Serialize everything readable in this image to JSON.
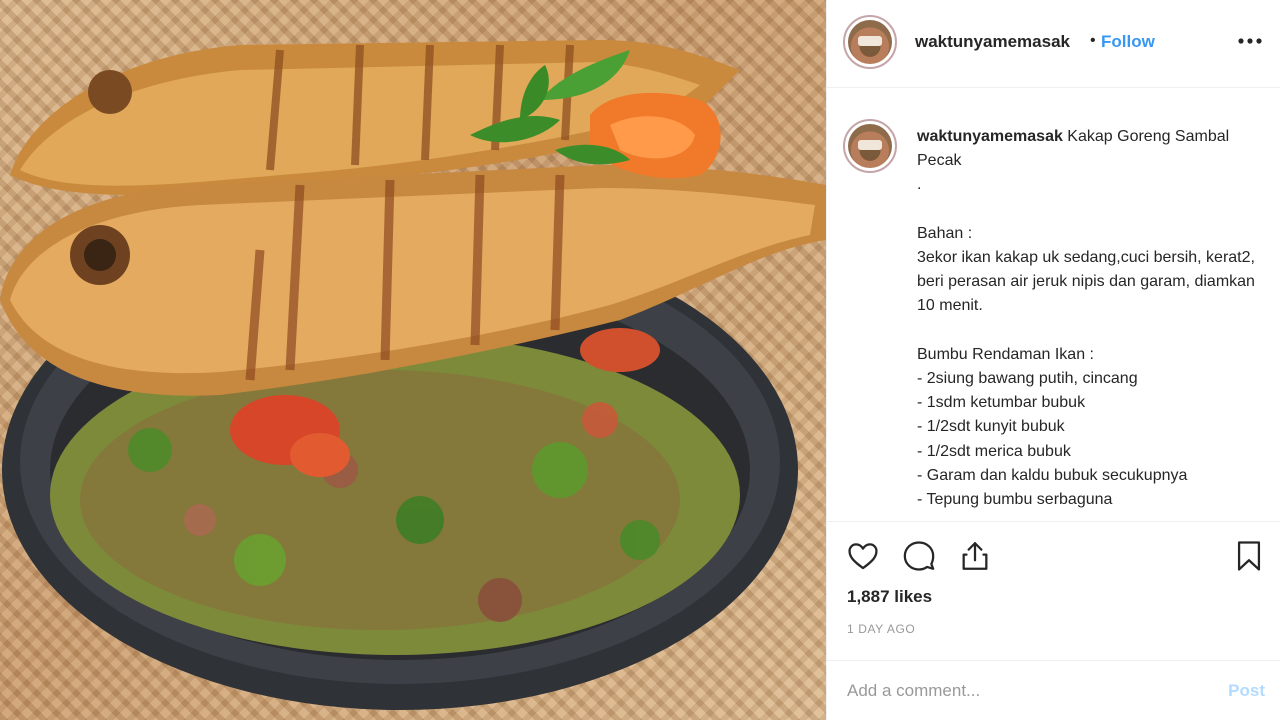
{
  "post": {
    "image_alt": "Kakap Goreng Sambal Pecak"
  },
  "header": {
    "username": "waktunyamemasak",
    "separator": "•",
    "follow_label": "Follow",
    "more_icon": "more-horizontal-icon"
  },
  "caption": {
    "username": "waktunyamemasak",
    "text": " Kakap Goreng Sambal Pecak\n.\n\nBahan :\n3ekor ikan kakap uk sedang,cuci bersih, kerat2, beri perasan air jeruk nipis dan garam, diamkan 10 menit.\n\nBumbu Rendaman Ikan :\n- 2siung bawang putih, cincang\n- 1sdm ketumbar bubuk\n- 1/2sdt kunyit bubuk\n- 1/2sdt merica bubuk\n- Garam dan kaldu bubuk secukupnya\n- Tepung bumbu serbaguna"
  },
  "actions": {
    "like_icon": "heart-icon",
    "comment_icon": "comment-icon",
    "share_icon": "share-icon",
    "save_icon": "bookmark-icon",
    "likes": "1,887 likes",
    "time": "1 DAY AGO"
  },
  "comment": {
    "placeholder": "Add a comment...",
    "post_label": "Post"
  },
  "colors": {
    "follow": "#3897f0",
    "post_disabled": "#b3dbff",
    "text": "#262626",
    "muted": "#999999",
    "divider": "#efefef"
  }
}
